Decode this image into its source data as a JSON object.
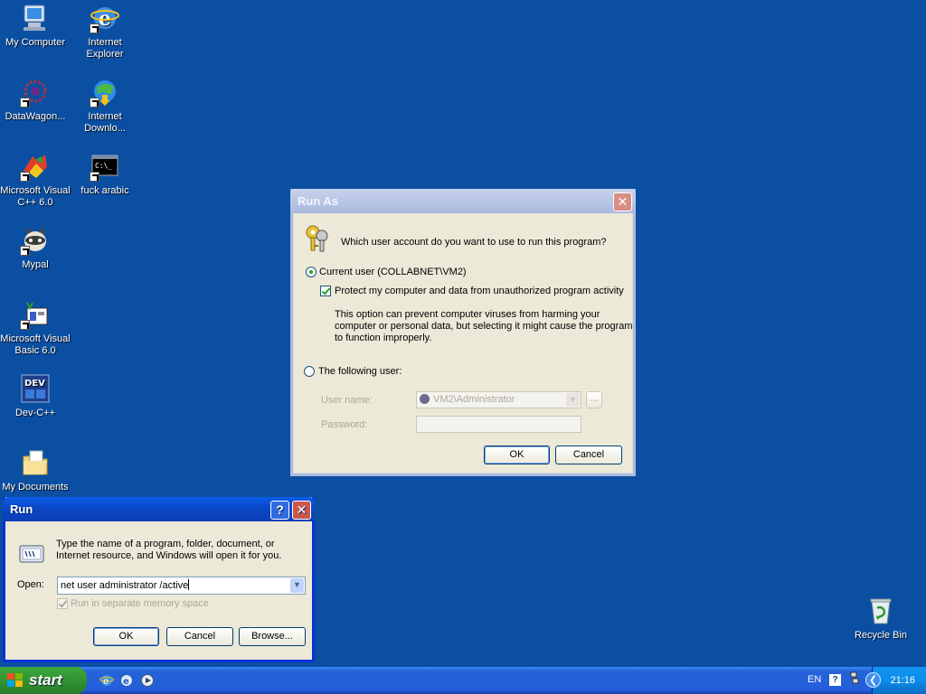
{
  "desktop": {
    "icons": [
      {
        "label": "My Computer"
      },
      {
        "label": "Internet\nExplorer"
      },
      {
        "label": "DataWagon..."
      },
      {
        "label": "Internet\nDownlo..."
      },
      {
        "label": "Microsoft Visual\nC++ 6.0"
      },
      {
        "label": "fuck arabic"
      },
      {
        "label": "Mypal"
      },
      {
        "label": "Microsoft Visual\nBasic 6.0"
      },
      {
        "label": "Dev-C++"
      },
      {
        "label": "My Documents"
      },
      {
        "label": "Recycle Bin"
      }
    ]
  },
  "run_as": {
    "title": "Run As",
    "question": "Which user account do you want to use to run this program?",
    "current_user_label": "Current user (COLLABNET\\VM2)",
    "protect_label": "Protect my computer and data from unauthorized program activity",
    "description": "This option can prevent computer viruses from harming your computer or personal data, but selecting it might cause the program to function improperly.",
    "following_user_label": "The following user:",
    "username_label": "User name:",
    "username_value": "VM2\\Administrator",
    "password_label": "Password:",
    "browse_small": "...",
    "ok": "OK",
    "cancel": "Cancel",
    "close_glyph": "✕"
  },
  "run": {
    "title": "Run",
    "help_glyph": "?",
    "close_glyph": "✕",
    "description": "Type the name of a program, folder, document, or Internet resource, and Windows will open it for you.",
    "open_label": "Open:",
    "open_value": "net user administrator /active",
    "separate_memory_label": "Run in separate memory space",
    "ok": "OK",
    "cancel": "Cancel",
    "browse": "Browse..."
  },
  "taskbar": {
    "start_label": "start",
    "language": "EN",
    "clock": "21:16"
  }
}
